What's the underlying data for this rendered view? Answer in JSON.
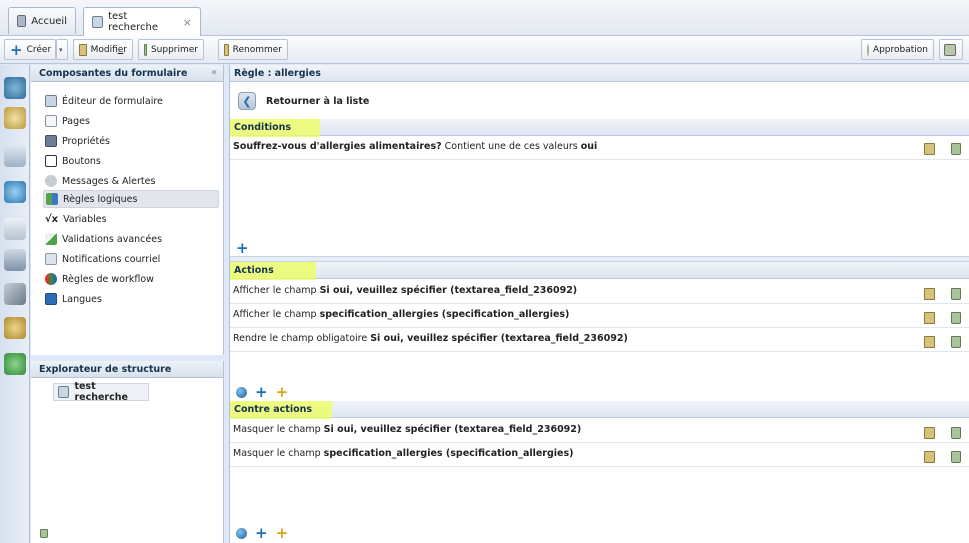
{
  "tabs": [
    {
      "label": "Accueil",
      "icon": "home-icon"
    },
    {
      "label": "test recherche",
      "icon": "form-icon",
      "close": "×"
    }
  ],
  "toolbar": {
    "create": "Créer",
    "modify_pre": "Modifi",
    "modify_u": "e",
    "modify_post": "r",
    "delete": "Supprimer",
    "rename": "Renommer",
    "approval": "Approbation"
  },
  "components": {
    "title": "Composantes du formulaire",
    "collapse": "«",
    "items": [
      {
        "label": "Éditeur de formulaire",
        "icon": "form-editor-icon"
      },
      {
        "label": "Pages",
        "icon": "pages-icon"
      },
      {
        "label": "Propriétés",
        "icon": "properties-icon"
      },
      {
        "label": "Boutons",
        "icon": "buttons-icon"
      },
      {
        "label": "Messages & Alertes",
        "icon": "messages-icon"
      },
      {
        "label": "Règles logiques",
        "icon": "logic-rules-icon"
      },
      {
        "label": "Variables",
        "icon": "variables-icon"
      },
      {
        "label": "Validations avancées",
        "icon": "validations-icon"
      },
      {
        "label": "Notifications courriel",
        "icon": "email-icon"
      },
      {
        "label": "Règles de workflow",
        "icon": "workflow-icon"
      },
      {
        "label": "Langues",
        "icon": "languages-icon"
      }
    ]
  },
  "explorer": {
    "title": "Explorateur de structure",
    "node": "test recherche"
  },
  "rule": {
    "title": "Règle : allergies",
    "back": "Retourner à la liste",
    "conditions_title": "Conditions",
    "condition": {
      "question": "Souffrez-vous d'allergies alimentaires?",
      "middle": " Contient une de ces valeurs ",
      "value": "oui"
    },
    "actions_title": "Actions",
    "actions": [
      {
        "prefix": "Afficher le champ ",
        "field": "Si oui, veuillez spécifier (textarea_field_236092)"
      },
      {
        "prefix": "Afficher le champ ",
        "field": "specification_allergies (specification_allergies)"
      },
      {
        "prefix": "Rendre le champ obligatoire ",
        "field": "Si oui, veuillez spécifier (textarea_field_236092)"
      }
    ],
    "counter_title": "Contre actions",
    "counter_actions": [
      {
        "prefix": "Masquer le champ ",
        "field": "Si oui, veuillez spécifier (textarea_field_236092)"
      },
      {
        "prefix": "Masquer le champ ",
        "field": "specification_allergies (specification_allergies)"
      }
    ]
  },
  "colors": {
    "highlight": "#eeff5a",
    "header_text": "#15324f",
    "accent": "#1d6fb8"
  }
}
